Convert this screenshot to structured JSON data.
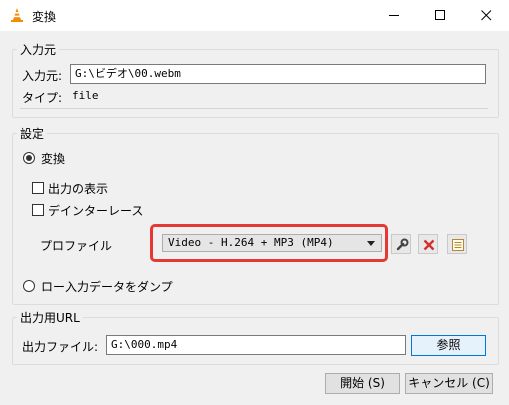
{
  "window": {
    "title": "変換",
    "app_icon": "vlc-cone-icon"
  },
  "source": {
    "legend": "入力元",
    "input_label": "入力元:",
    "input_value": "G:\\ビデオ\\00.webm",
    "type_label": "タイプ:",
    "type_value": "file"
  },
  "settings": {
    "legend": "設定",
    "convert_label": "変換",
    "show_output_label": "出力の表示",
    "deinterlace_label": "デインターレース",
    "profile_label": "プロファイル",
    "profile_value": "Video - H.264 + MP3 (MP4)",
    "dump_label": "ロー入力データをダンプ"
  },
  "destination": {
    "legend": "出力用URL",
    "file_label": "出力ファイル:",
    "file_value": "G:\\000.mp4",
    "browse_label": "参照"
  },
  "footer": {
    "start_label": "開始 (S)",
    "cancel_label": "キャンセル (C)"
  },
  "colors": {
    "highlight": "#e53935",
    "delete_red": "#d32f2f",
    "accent": "#0078d7"
  }
}
